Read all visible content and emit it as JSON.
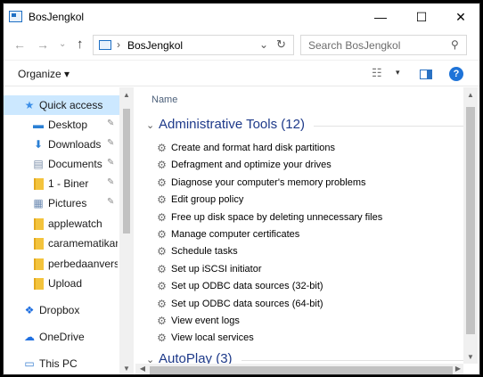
{
  "window": {
    "title": "BosJengkol"
  },
  "caption": {
    "minimize": "—",
    "maximize": "☐",
    "close": "✕"
  },
  "address": {
    "back": "←",
    "forward": "→",
    "up": "↑",
    "separator": "›",
    "path": "BosJengkol",
    "dropdown": "⌄",
    "refresh": "↻"
  },
  "search": {
    "placeholder": "Search BosJengkol",
    "icon": "search-icon"
  },
  "command": {
    "organize": "Organize ▾",
    "view_dropdown": "▾"
  },
  "nav": {
    "items": [
      {
        "label": "Quick access",
        "icon": "star-icon",
        "selected": true
      },
      {
        "label": "Desktop",
        "icon": "desktop-icon",
        "pinned": true
      },
      {
        "label": "Downloads",
        "icon": "download-icon",
        "pinned": true
      },
      {
        "label": "Documents",
        "icon": "documents-icon",
        "pinned": true
      },
      {
        "label": "1 - Biner",
        "icon": "folder-icon",
        "pinned": true
      },
      {
        "label": "Pictures",
        "icon": "pictures-icon",
        "pinned": true
      },
      {
        "label": "applewatch",
        "icon": "folder-icon"
      },
      {
        "label": "caramematikanv",
        "icon": "folder-icon"
      },
      {
        "label": "perbedaanversiv",
        "icon": "folder-icon"
      },
      {
        "label": "Upload",
        "icon": "folder-icon"
      },
      {
        "label": "Dropbox",
        "icon": "dropbox-icon"
      },
      {
        "label": "OneDrive",
        "icon": "onedrive-icon"
      },
      {
        "label": "This PC",
        "icon": "this-pc-icon"
      }
    ]
  },
  "content": {
    "column_header": "Name",
    "groups": [
      {
        "title": "Administrative Tools (12)",
        "items": [
          "Create and format hard disk partitions",
          "Defragment and optimize your drives",
          "Diagnose your computer's memory problems",
          "Edit group policy",
          "Free up disk space by deleting unnecessary files",
          "Manage computer certificates",
          "Schedule tasks",
          "Set up iSCSI initiator",
          "Set up ODBC data sources (32-bit)",
          "Set up ODBC data sources (64-bit)",
          "View event logs",
          "View local services"
        ]
      },
      {
        "title": "AutoPlay (3)",
        "items": []
      }
    ]
  },
  "colors": {
    "accent": "#1e73d8",
    "selection": "#cce8ff",
    "group_title": "#1e3a8a",
    "folder": "#f3c33c"
  }
}
